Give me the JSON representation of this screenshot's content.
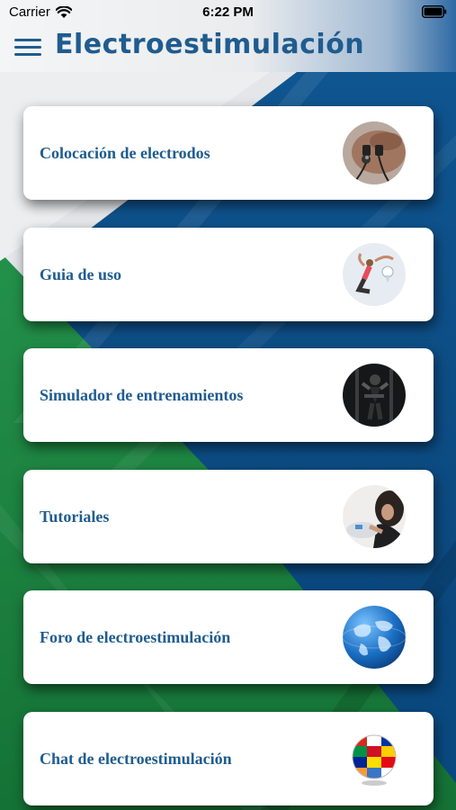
{
  "status_bar": {
    "carrier": "Carrier",
    "time": "6:22 PM"
  },
  "navbar": {
    "title": "Electroestimulación"
  },
  "menu": {
    "items": [
      {
        "label": "Colocación de electrodos",
        "icon": "electrodes-photo-icon"
      },
      {
        "label": "Guia de uso",
        "icon": "fitness-woman-photo-icon"
      },
      {
        "label": "Simulador de entrenamientos",
        "icon": "gym-training-photo-icon"
      },
      {
        "label": "Tutoriales",
        "icon": "tutorial-photo-icon"
      },
      {
        "label": "Foro de electroestimulación",
        "icon": "globe-icon"
      },
      {
        "label": "Chat de electroestimulación",
        "icon": "flags-globe-icon"
      }
    ]
  },
  "colors": {
    "title_blue": "#1f5c8f",
    "bg_blue": "#0c4f86",
    "bg_green": "#1f8a3d",
    "card_white": "#ffffff"
  }
}
